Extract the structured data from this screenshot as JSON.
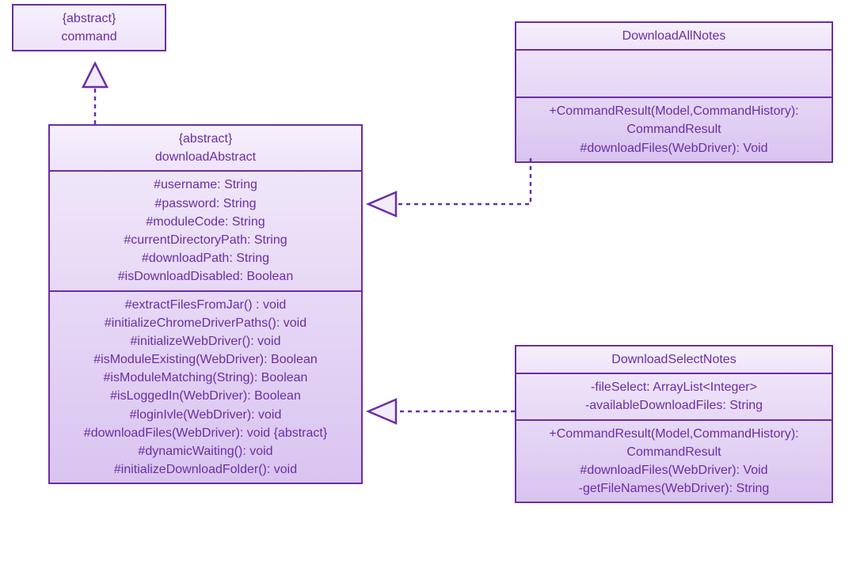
{
  "command": {
    "stereotype": "{abstract}",
    "name": "command"
  },
  "downloadAbstract": {
    "stereotype": "{abstract}",
    "name": "downloadAbstract",
    "attrs": [
      "#username: String",
      "#password: String",
      "#moduleCode: String",
      "#currentDirectoryPath: String",
      "#downloadPath: String",
      "#isDownloadDisabled: Boolean"
    ],
    "ops": [
      "#extractFilesFromJar() : void",
      "#initializeChromeDriverPaths(): void",
      "#initializeWebDriver(): void",
      "#isModuleExisting(WebDriver): Boolean",
      "#isModuleMatching(String): Boolean",
      "#isLoggedIn(WebDriver): Boolean",
      "#loginIvle(WebDriver): void",
      "#downloadFiles(WebDriver): void {abstract}",
      "#dynamicWaiting(): void",
      "#initializeDownloadFolder(): void"
    ]
  },
  "downloadAllNotes": {
    "name": "DownloadAllNotes",
    "ops": [
      "+CommandResult(Model,CommandHistory):",
      "CommandResult",
      "#downloadFiles(WebDriver): Void"
    ]
  },
  "downloadSelectNotes": {
    "name": "DownloadSelectNotes",
    "attrs": [
      "-fileSelect: ArrayList<Integer>",
      "-availableDownloadFiles: String"
    ],
    "ops": [
      "+CommandResult(Model,CommandHistory):",
      "CommandResult",
      "#downloadFiles(WebDriver): Void",
      "-getFileNames(WebDriver): String"
    ]
  }
}
